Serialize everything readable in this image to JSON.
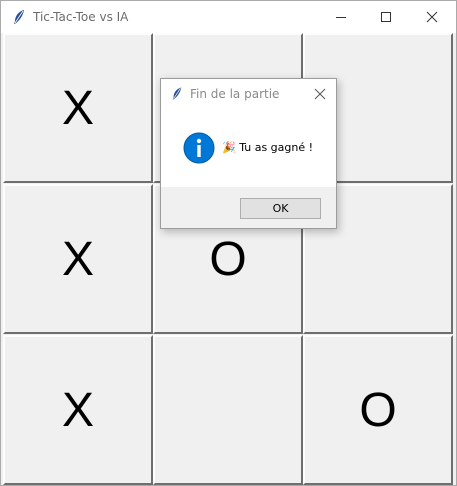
{
  "window": {
    "title": "Tic-Tac-Toe vs IA",
    "icon": "feather-icon",
    "controls": [
      "minimize-icon",
      "maximize-icon",
      "close-icon"
    ]
  },
  "board": {
    "cells": [
      [
        "X",
        "",
        ""
      ],
      [
        "X",
        "O",
        ""
      ],
      [
        "X",
        "",
        "O"
      ]
    ]
  },
  "dialog": {
    "title": "Fin de la partie",
    "icon": "info-icon",
    "message": "🎉 Tu as gagné !",
    "ok_label": "OK"
  },
  "colors": {
    "accent": "#0078d7",
    "cell_bg": "#f0f0f0",
    "titlebar_bg": "#ffffff"
  }
}
